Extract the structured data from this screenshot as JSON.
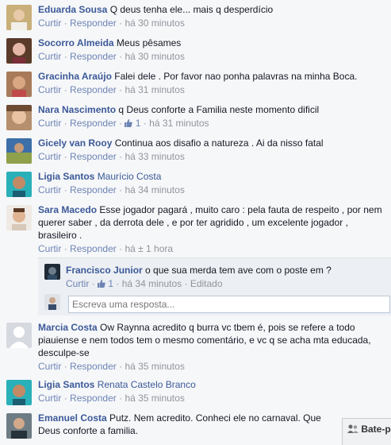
{
  "actions": {
    "like": "Curtir",
    "reply": "Responder",
    "separator": "·",
    "edited": "Editado"
  },
  "comments": [
    {
      "name": "Eduarda Sousa",
      "text": "Q deus tenha ele... mais q desperdício",
      "time": "há 30 minutos"
    },
    {
      "name": "Socorro Almeida",
      "text": "Meus pêsames",
      "time": "há 30 minutos"
    },
    {
      "name": "Gracinha Araújo",
      "text": "Falei dele . Por favor nao ponha palavras na minha Boca.",
      "time": "há 31 minutos"
    },
    {
      "name": "Nara Nascimento",
      "text": "q Deus conforte a Familia neste momento dificil",
      "likes": "1",
      "time": "há 31 minutos"
    },
    {
      "name": "Gicely van Rooy",
      "text": "Continua aos disafio a natureza . Ai da nisso fatal",
      "time": "há 33 minutos"
    },
    {
      "name": "Ligia Santos",
      "tag": "Maurício Costa",
      "time": "há 34 minutos"
    },
    {
      "name": "Sara Macedo",
      "text": "Esse jogador pagará , muito caro : pela fauta de respeito , por nem querer saber , da derrota dele , e por ter agridido , um excelente jogador , brasileiro .",
      "time": "há ± 1 hora"
    },
    {
      "name": "Marcia Costa",
      "text": "Ow Raynna acredito q burra vc tbem é, pois se refere a todo piauiense e nem todos tem o mesmo comentário, e vc q se acha mta educada, desculpe-se",
      "time": "há 35 minutos"
    },
    {
      "name": "Ligia Santos",
      "tag": "Renata Castelo Branco",
      "time": "há 35 minutos"
    },
    {
      "name": "Emanuel Costa",
      "text": "Putz. Nem acredito. Conheci ele no carnaval. Que Deus conforte a familia."
    }
  ],
  "reply": {
    "name": "Francisco Junior",
    "text": "o que sua merda tem ave com o poste em ?",
    "likes": "1",
    "time": "há 34 minutos",
    "input_placeholder": "Escreva uma resposta..."
  },
  "chat_tab": {
    "label": "Bate-p"
  },
  "colors": {
    "link": "#3b5998",
    "meta": "#90949c",
    "action": "#6d84b4",
    "background": "#f6f7f9"
  }
}
